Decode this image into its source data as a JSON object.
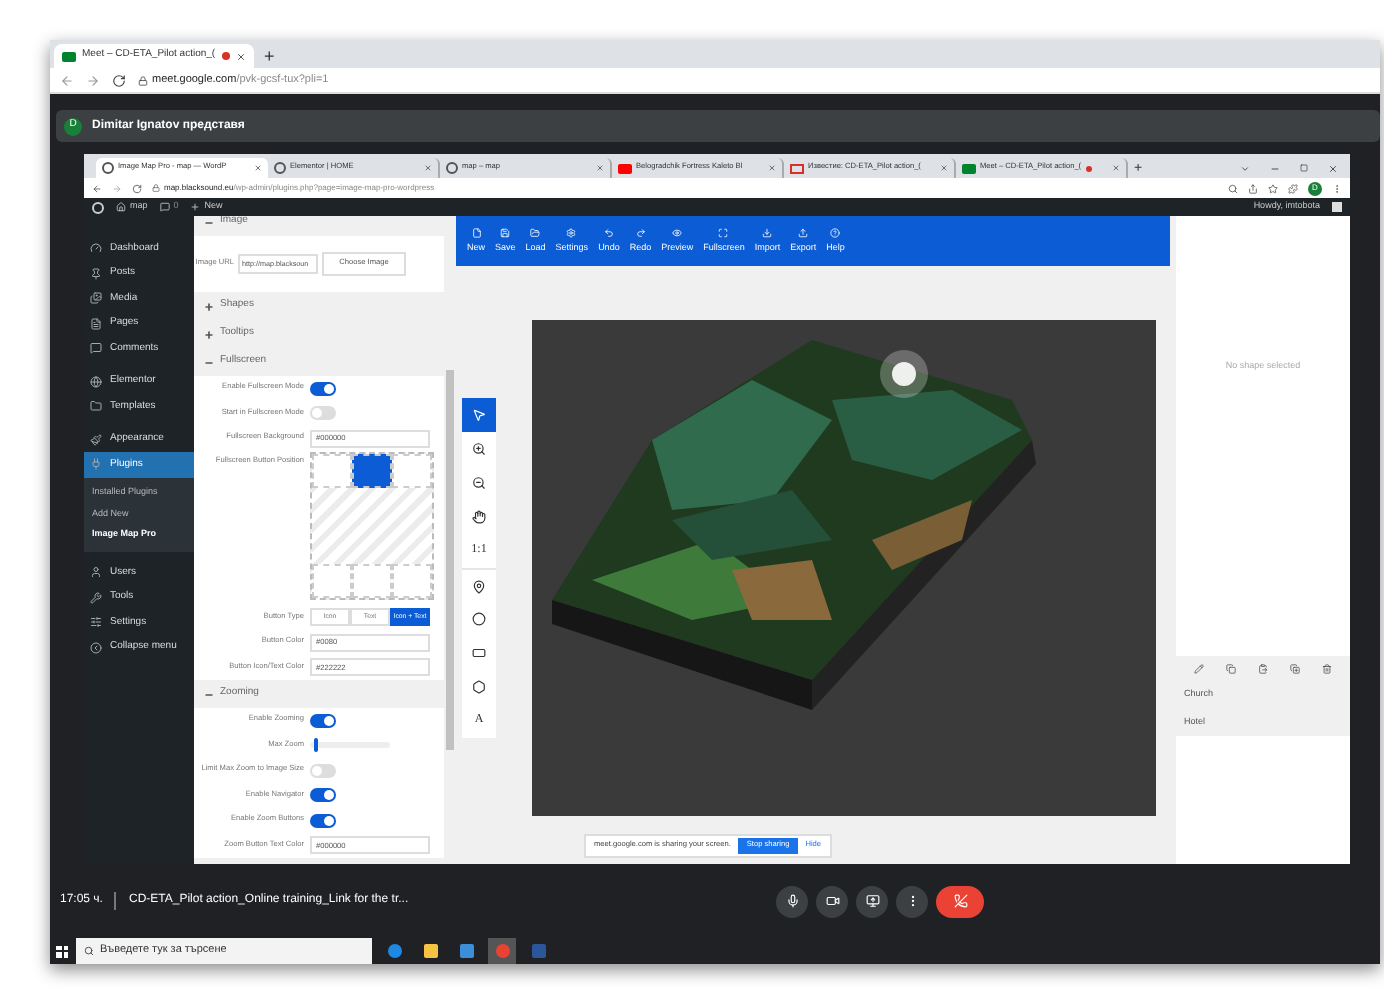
{
  "outer_browser": {
    "tabs": [
      {
        "title": "Meet – CD-ETA_Pilot action_(",
        "recording": true,
        "selected": true
      }
    ],
    "new_tab": "+",
    "url_host": "meet.google.com",
    "url_path": "/pvk-gcsf-tux?pli=1"
  },
  "presenter": {
    "avatar": "D",
    "text": "Dimitar Ignatov представя"
  },
  "shared_screen": {
    "browser": {
      "tabs": [
        {
          "title": "Image Map Pro - map — WordP",
          "kind": "wp",
          "selected": true,
          "recording": false
        },
        {
          "title": "Elementor | HOME",
          "kind": "elementor",
          "selected": false,
          "recording": false
        },
        {
          "title": "map – map",
          "kind": "wp",
          "selected": false,
          "recording": false
        },
        {
          "title": "Belogradchik Fortress Kaleto Bl",
          "kind": "youtube",
          "selected": false,
          "recording": false
        },
        {
          "title": "Известие: CD-ETA_Pilot action_(",
          "kind": "gmail",
          "selected": false,
          "recording": false
        },
        {
          "title": "Meet – CD-ETA_Pilot action_(",
          "kind": "meet",
          "selected": false,
          "recording": true
        }
      ],
      "new_tab": "+",
      "url_host": "map.blacksound.eu",
      "url_path": "/wp-admin/plugins.php?page=image-map-pro-wordpress",
      "profile": "D"
    },
    "admin_bar": {
      "site": "map",
      "comments": "0",
      "new": "New",
      "greeting": "Howdy, imtobota"
    },
    "sidebar": {
      "items": [
        {
          "label": "Dashboard",
          "selected": false
        },
        {
          "label": "Posts",
          "selected": false
        },
        {
          "label": "Media",
          "selected": false
        },
        {
          "label": "Pages",
          "selected": false
        },
        {
          "label": "Comments",
          "selected": false
        },
        {
          "label": "Elementor",
          "selected": false
        },
        {
          "label": "Templates",
          "selected": false
        },
        {
          "label": "Appearance",
          "selected": false
        },
        {
          "label": "Plugins",
          "selected": true,
          "children": [
            {
              "label": "Installed Plugins",
              "selected": false
            },
            {
              "label": "Add New",
              "selected": false
            },
            {
              "label": "Image Map Pro",
              "selected": true
            }
          ]
        },
        {
          "label": "Users",
          "selected": false
        },
        {
          "label": "Tools",
          "selected": false
        },
        {
          "label": "Settings",
          "selected": false
        },
        {
          "label": "Collapse menu",
          "selected": false
        }
      ]
    },
    "settings": {
      "sections": [
        {
          "title": "Image",
          "expanded": true,
          "rows": [
            {
              "kind": "field_button",
              "label": "Image URL",
              "value": "http://map.blacksoun",
              "button": "Choose Image"
            }
          ]
        },
        {
          "title": "Shapes",
          "expanded": false
        },
        {
          "title": "Tooltips",
          "expanded": false
        },
        {
          "title": "Fullscreen",
          "expanded": true,
          "rows": [
            {
              "kind": "toggle",
              "label": "Enable Fullscreen Mode",
              "on": true
            },
            {
              "kind": "toggle",
              "label": "Start in Fullscreen Mode",
              "on": false
            },
            {
              "kind": "field",
              "label": "Fullscreen Background",
              "value": "#000000"
            },
            {
              "kind": "position",
              "label": "Fullscreen Button Position",
              "positions": [
                {
                  "selected": false
                },
                {
                  "selected": true
                },
                {
                  "selected": false
                },
                {
                  "selected": false
                },
                {
                  "selected": false
                },
                {
                  "selected": false
                }
              ]
            },
            {
              "kind": "segmented",
              "label": "Button Type",
              "options": [
                {
                  "label": "Icon",
                  "selected": false
                },
                {
                  "label": "Text",
                  "selected": false
                },
                {
                  "label": "Icon + Text",
                  "selected": true
                }
              ]
            },
            {
              "kind": "field",
              "label": "Button Color",
              "value": "#0080"
            },
            {
              "kind": "field",
              "label": "Button Icon/Text Color",
              "value": "#222222"
            }
          ]
        },
        {
          "title": "Zooming",
          "expanded": true,
          "rows": [
            {
              "kind": "toggle",
              "label": "Enable Zooming",
              "on": true
            },
            {
              "kind": "slider",
              "label": "Max Zoom",
              "level": 0.05
            },
            {
              "kind": "toggle",
              "label": "Limit Max Zoom to Image Size",
              "on": false
            },
            {
              "kind": "toggle",
              "label": "Enable Navigator",
              "on": true
            },
            {
              "kind": "toggle",
              "label": "Enable Zoom Buttons",
              "on": true
            },
            {
              "kind": "field",
              "label": "Zoom Button Text Color",
              "value": "#000000"
            }
          ]
        }
      ]
    },
    "toolbar": [
      "New",
      "Save",
      "Load",
      "Settings",
      "Undo",
      "Redo",
      "Preview",
      "Fullscreen",
      "Import",
      "Export",
      "Help"
    ],
    "tools": [
      {
        "kind": "icon",
        "selected": true
      },
      {
        "kind": "icon",
        "selected": false
      },
      {
        "kind": "icon",
        "selected": false
      },
      {
        "kind": "icon",
        "selected": false
      },
      {
        "kind": "text",
        "label": "1:1",
        "selected": false
      },
      {
        "kind": "icon",
        "selected": false
      },
      {
        "kind": "icon",
        "selected": false
      },
      {
        "kind": "icon",
        "selected": false
      },
      {
        "kind": "icon",
        "selected": false
      },
      {
        "kind": "text",
        "label": "A",
        "selected": false
      }
    ],
    "shapes_panel": {
      "empty_text": "No shape selected",
      "layers": [
        {
          "label": "Church"
        },
        {
          "label": "Hotel"
        }
      ]
    },
    "share_banner": {
      "text": "meet.google.com is sharing your screen.",
      "stop": "Stop sharing",
      "hide": "Hide"
    }
  },
  "meeting_bar": {
    "time": "17:05 ч.",
    "title": "CD-ETA_Pilot action_Online training_Link for the tr..."
  },
  "taskbar": {
    "search_placeholder": "Въведете тук за търсене",
    "apps": [
      {
        "selected": false
      },
      {
        "selected": false
      },
      {
        "selected": false
      },
      {
        "selected": true
      },
      {
        "selected": false
      }
    ]
  }
}
